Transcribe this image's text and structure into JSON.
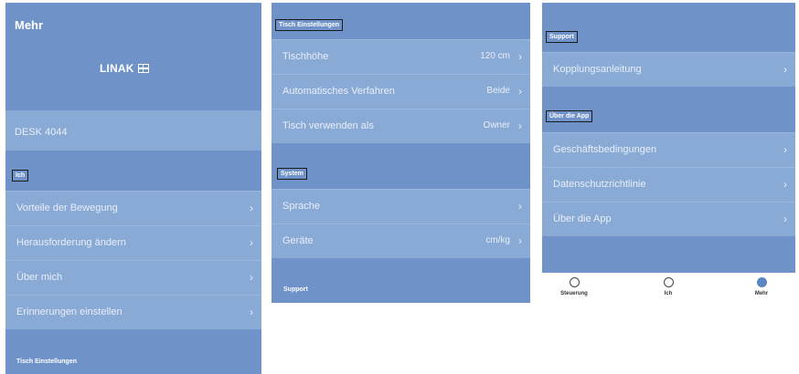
{
  "panel1": {
    "header_title": "Mehr",
    "logo_text": "LINAK",
    "desk_name": "DESK 4044",
    "section_ich": "Ich",
    "items": [
      {
        "label": "Vorteile der Bewegung"
      },
      {
        "label": "Herausforderung ändern"
      },
      {
        "label": "Über mich"
      },
      {
        "label": "Erinnerungen einstellen"
      }
    ],
    "section_tisch": "Tisch Einstellungen"
  },
  "panel2": {
    "section_tisch": "Tisch Einstellungen",
    "tisch_items": [
      {
        "label": "Tischhöhe",
        "value": "120 cm"
      },
      {
        "label": "Automatisches Verfahren",
        "value": "Beide"
      },
      {
        "label": "Tisch verwenden als",
        "value": "Owner"
      }
    ],
    "section_system": "System",
    "system_items": [
      {
        "label": "Sprache",
        "value": ""
      },
      {
        "label": "Geräte",
        "value": "cm/kg"
      }
    ],
    "section_support": "Support"
  },
  "panel3": {
    "section_support": "Support",
    "support_items": [
      {
        "label": "Kopplungsanleitung"
      }
    ],
    "section_app": "Über die App",
    "app_items": [
      {
        "label": "Geschäftsbedingungen"
      },
      {
        "label": "Datenschutzrichtlinie"
      },
      {
        "label": "Über die App"
      }
    ],
    "nav": [
      {
        "label": "Steuerung",
        "icon": "smiley-icon"
      },
      {
        "label": "Ich",
        "icon": "user-icon"
      },
      {
        "label": "Mehr",
        "icon": "more-icon"
      }
    ]
  },
  "chevron": "›",
  "colors": {
    "panel_bg": "#8aaad6",
    "section_bg": "#6f93c8",
    "text": "#ffffff",
    "accent": "#5b86c4"
  }
}
